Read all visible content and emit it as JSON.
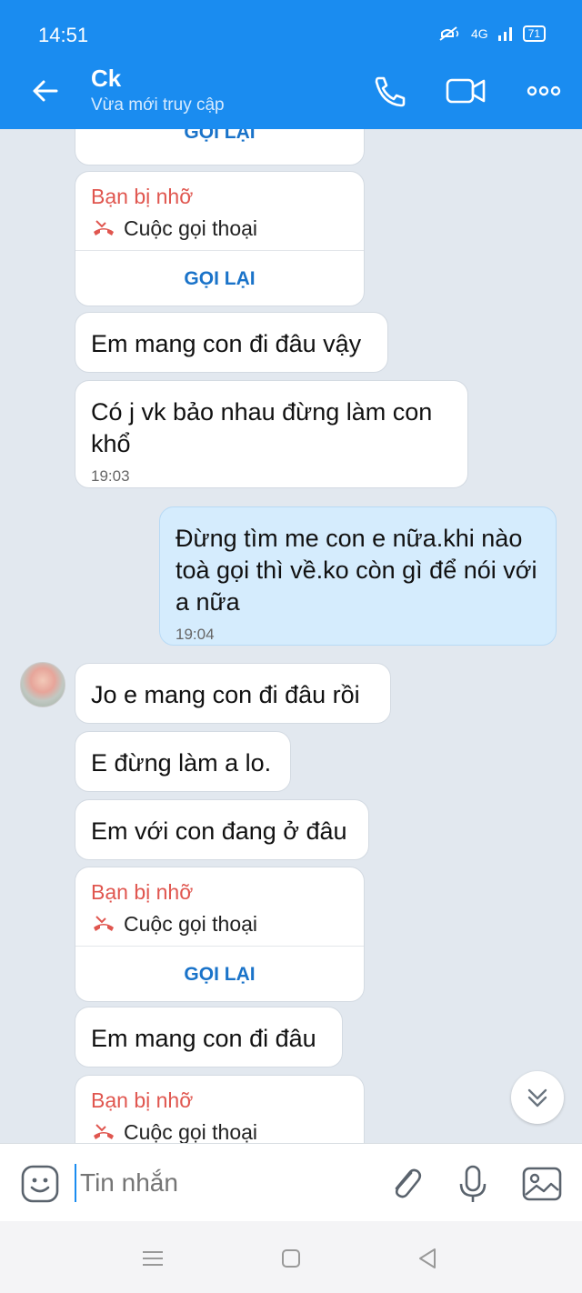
{
  "status_bar": {
    "time": "14:51",
    "network": "4G",
    "battery": "71"
  },
  "header": {
    "name": "Ck",
    "status": "Vừa mới truy cập"
  },
  "messages": {
    "call_back_top": "GỌI LẠI",
    "call1": {
      "missed": "Bạn bị nhỡ",
      "type": "Cuộc gọi thoại",
      "action": "GỌI LẠI"
    },
    "m1": {
      "text": "Em mang con đi đâu vậy"
    },
    "m2": {
      "text": "Có j vk bảo nhau đừng làm con khổ",
      "time": "19:03"
    },
    "m3": {
      "text": "Đừng tìm me con e nữa.khi nào toà gọi thì về.ko còn gì để nói với a nữa",
      "time": "19:04"
    },
    "m4": {
      "text": "Jo e mang con đi đâu rồi"
    },
    "m5": {
      "text": "E đừng làm a lo."
    },
    "m6": {
      "text": "Em với con đang ở đâu"
    },
    "call2": {
      "missed": "Bạn bị nhỡ",
      "type": "Cuộc gọi thoại",
      "action": "GỌI LẠI"
    },
    "m7": {
      "text": "Em mang con đi đâu"
    },
    "call3": {
      "missed": "Bạn bị nhỡ",
      "type": "Cuộc gọi thoại"
    }
  },
  "input": {
    "placeholder": "Tin nhắn"
  },
  "icons": {
    "back": "arrow-left-icon",
    "call": "phone-icon",
    "video": "video-icon",
    "more": "more-dots-icon",
    "emoji": "emoji-icon",
    "attach": "paperclip-icon",
    "mic": "microphone-icon",
    "image": "image-icon",
    "missed_call": "missed-call-icon",
    "scroll_down": "chevrons-down-icon"
  },
  "colors": {
    "primary": "#1a8cf0",
    "missed": "#e0564f",
    "link": "#1a73c9",
    "my_bubble": "#d5ecfd",
    "background": "#e2e8ef"
  }
}
